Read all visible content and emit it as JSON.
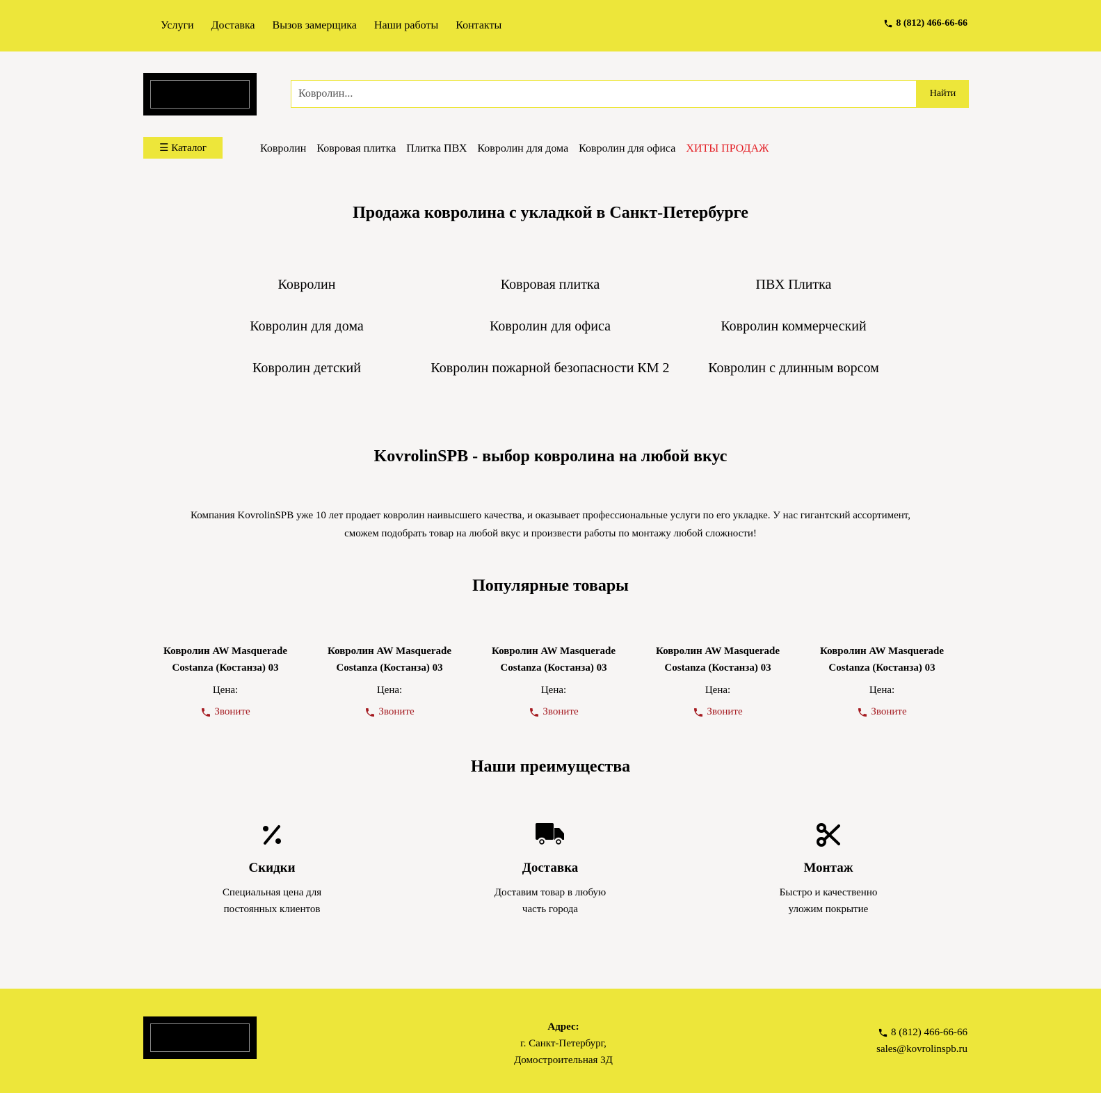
{
  "header": {
    "nav": [
      "Услуги",
      "Доставка",
      "Вызов замерщика",
      "Наши работы",
      "Контакты"
    ],
    "phone": "8 (812) 466-66-66",
    "phone_icon": "phone-icon"
  },
  "search": {
    "placeholder": "Ковролин...",
    "value": "",
    "button_label": "Найти"
  },
  "catalog": {
    "button_label": "☰ Каталог",
    "nav": [
      "Ковролин",
      "Ковровая плитка",
      "Плитка ПВХ",
      "Ковролин для дома",
      "Ковролин для офиса"
    ],
    "hit_label": "ХИТЫ ПРОДАЖ",
    "hit_color": "#e31e24"
  },
  "main": {
    "title": "Продажа ковролина с укладкой в Санкт-Петербурге",
    "categories": [
      "Ковролин",
      "Ковровая плитка",
      "ПВХ Плитка",
      "Ковролин для дома",
      "Ковролин для офиса",
      "Ковролин коммерческий",
      "Ковролин детский",
      "Ковролин пожарной безопасности КМ 2",
      "Ковролин с длинным ворсом"
    ],
    "about_title": "KovrolinSPB - выбор ковролина на любой вкус",
    "about_text": "Компания KovrolinSPB уже 10 лет продает ковролин наивысшего качества, и оказывает профессиональные услуги по его укладке. У нас гигантский ассортимент, сможем подобрать товар на любой вкус и произвести работы по монтажу любой сложности!"
  },
  "popular": {
    "title": "Популярные товары",
    "items": [
      {
        "name": "Ковролин AW Masquerade Costanza (Костанза) 03",
        "price_label": "Цена:",
        "call_label": "Звоните"
      },
      {
        "name": "Ковролин AW Masquerade Costanza (Костанза) 03",
        "price_label": "Цена:",
        "call_label": "Звоните"
      },
      {
        "name": "Ковролин AW Masquerade Costanza (Костанза) 03",
        "price_label": "Цена:",
        "call_label": "Звоните"
      },
      {
        "name": "Ковролин AW Masquerade Costanza (Костанза) 03",
        "price_label": "Цена:",
        "call_label": "Звоните"
      },
      {
        "name": "Ковролин AW Masquerade Costanza (Костанза) 03",
        "price_label": "Цена:",
        "call_label": "Звоните"
      }
    ],
    "call_color": "#a51b21"
  },
  "advantages": {
    "title": "Наши преимущества",
    "items": [
      {
        "icon": "percent-icon",
        "title": "Скидки",
        "text": "Специальная цена для постоянных клиентов"
      },
      {
        "icon": "truck-icon",
        "title": "Доставка",
        "text": "Доставим товар в любую часть города"
      },
      {
        "icon": "scissors-icon",
        "title": "Монтаж",
        "text": "Быстро и качественно уложим покрытие"
      }
    ]
  },
  "footer": {
    "address_label": "Адрес:",
    "address_line1": "г. Санкт-Петербург,",
    "address_line2": "Домостроительная 3Д",
    "phone": "8 (812) 466-66-66",
    "email": "sales@kovrolinspb.ru"
  },
  "colors": {
    "accent": "#ede63a",
    "background": "#f7f5f4"
  }
}
